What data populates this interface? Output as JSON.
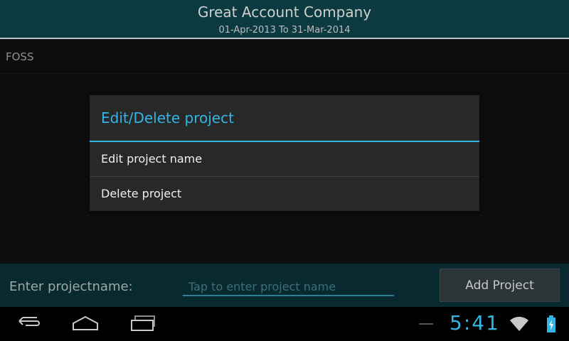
{
  "header": {
    "title": "Great Account Company",
    "subtitle": "01-Apr-2013 To 31-Mar-2014"
  },
  "list": {
    "items": [
      {
        "label": "FOSS"
      }
    ]
  },
  "dialog": {
    "title": "Edit/Delete project",
    "options": [
      {
        "label": "Edit project name"
      },
      {
        "label": "Delete project"
      }
    ]
  },
  "form": {
    "prompt": "Enter projectname:",
    "input_placeholder": "Tap to enter project name",
    "input_value": "",
    "add_button": "Add Project"
  },
  "system_bar": {
    "time": "5:41",
    "icons": [
      "back-icon",
      "home-icon",
      "recents-icon",
      "wifi-icon",
      "battery-icon"
    ]
  },
  "colors": {
    "accent": "#33b5e5",
    "header_bg": "#0b3a40",
    "bottom_bar_bg": "#082a2e"
  }
}
